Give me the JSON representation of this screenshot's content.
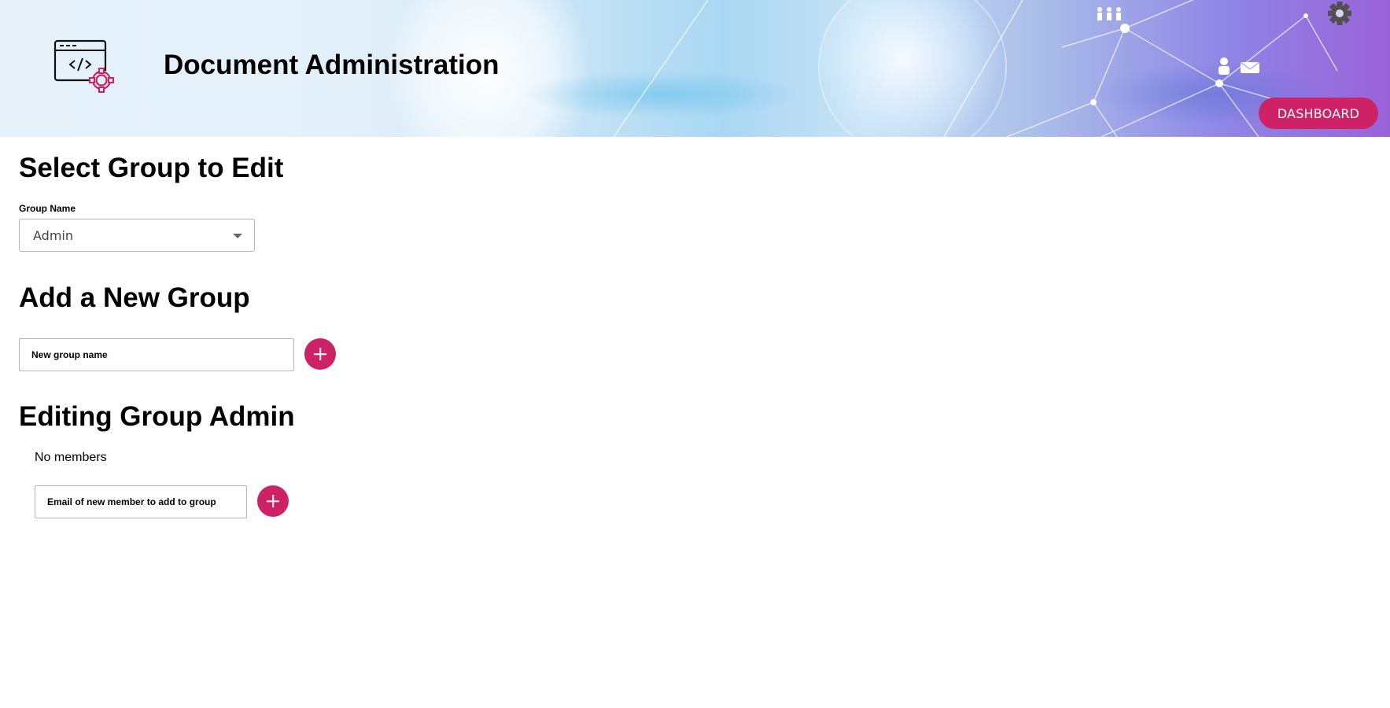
{
  "header": {
    "title": "Document Administration",
    "dashboard_label": "DASHBOARD",
    "logo_icon": "code-window-gear-icon",
    "settings_icon": "gear-icon"
  },
  "select_group": {
    "heading": "Select Group to Edit",
    "label": "Group Name",
    "selected": "Admin"
  },
  "add_group": {
    "heading": "Add a New Group",
    "placeholder": "New group name",
    "button_icon": "plus-icon"
  },
  "edit_group": {
    "heading": "Editing Group Admin",
    "members_text": "No members",
    "placeholder": "Email of new member to add to group",
    "button_icon": "plus-icon"
  },
  "colors": {
    "accent": "#cd2266"
  }
}
